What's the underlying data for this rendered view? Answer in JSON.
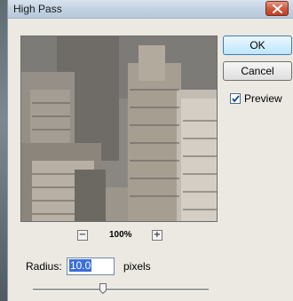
{
  "dialog": {
    "title": "High Pass",
    "buttons": {
      "ok": "OK",
      "cancel": "Cancel"
    },
    "preview": {
      "label": "Preview",
      "checked": true
    },
    "zoom": {
      "minus": "−",
      "plus": "+",
      "level": "100%"
    },
    "radius": {
      "label": "Radius:",
      "value": "10.0",
      "units": "pixels",
      "slider_fraction": 0.4
    },
    "icons": {
      "close": "close-icon",
      "checkmark": "checkmark-icon"
    },
    "colors": {
      "ok_border": "#3c7fb1",
      "close": "#c0412a",
      "selection": "#3a6fd8"
    }
  }
}
